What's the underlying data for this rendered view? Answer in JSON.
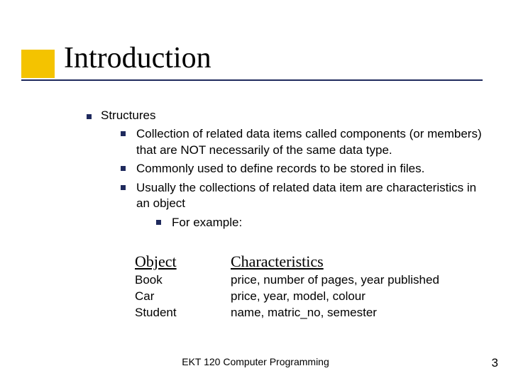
{
  "title": "Introduction",
  "heading": "Structures",
  "points": {
    "p1": "Collection of related data items called components (or members) that are NOT necessarily of the same data type.",
    "p2": "Commonly used to define records to be stored in files.",
    "p3": "Usually the collections of related data item are characteristics in an object",
    "p3a": "For example:"
  },
  "table": {
    "header_object": "Object",
    "header_char": "Characteristics",
    "rows": {
      "r1o": "Book",
      "r1c": "price, number of pages, year published",
      "r2o": "Car",
      "r2c": "price, year, model, colour",
      "r3o": "Student",
      "r3c": "name, matric_no, semester"
    }
  },
  "footer": "EKT 120 Computer Programming",
  "page_number": "3"
}
